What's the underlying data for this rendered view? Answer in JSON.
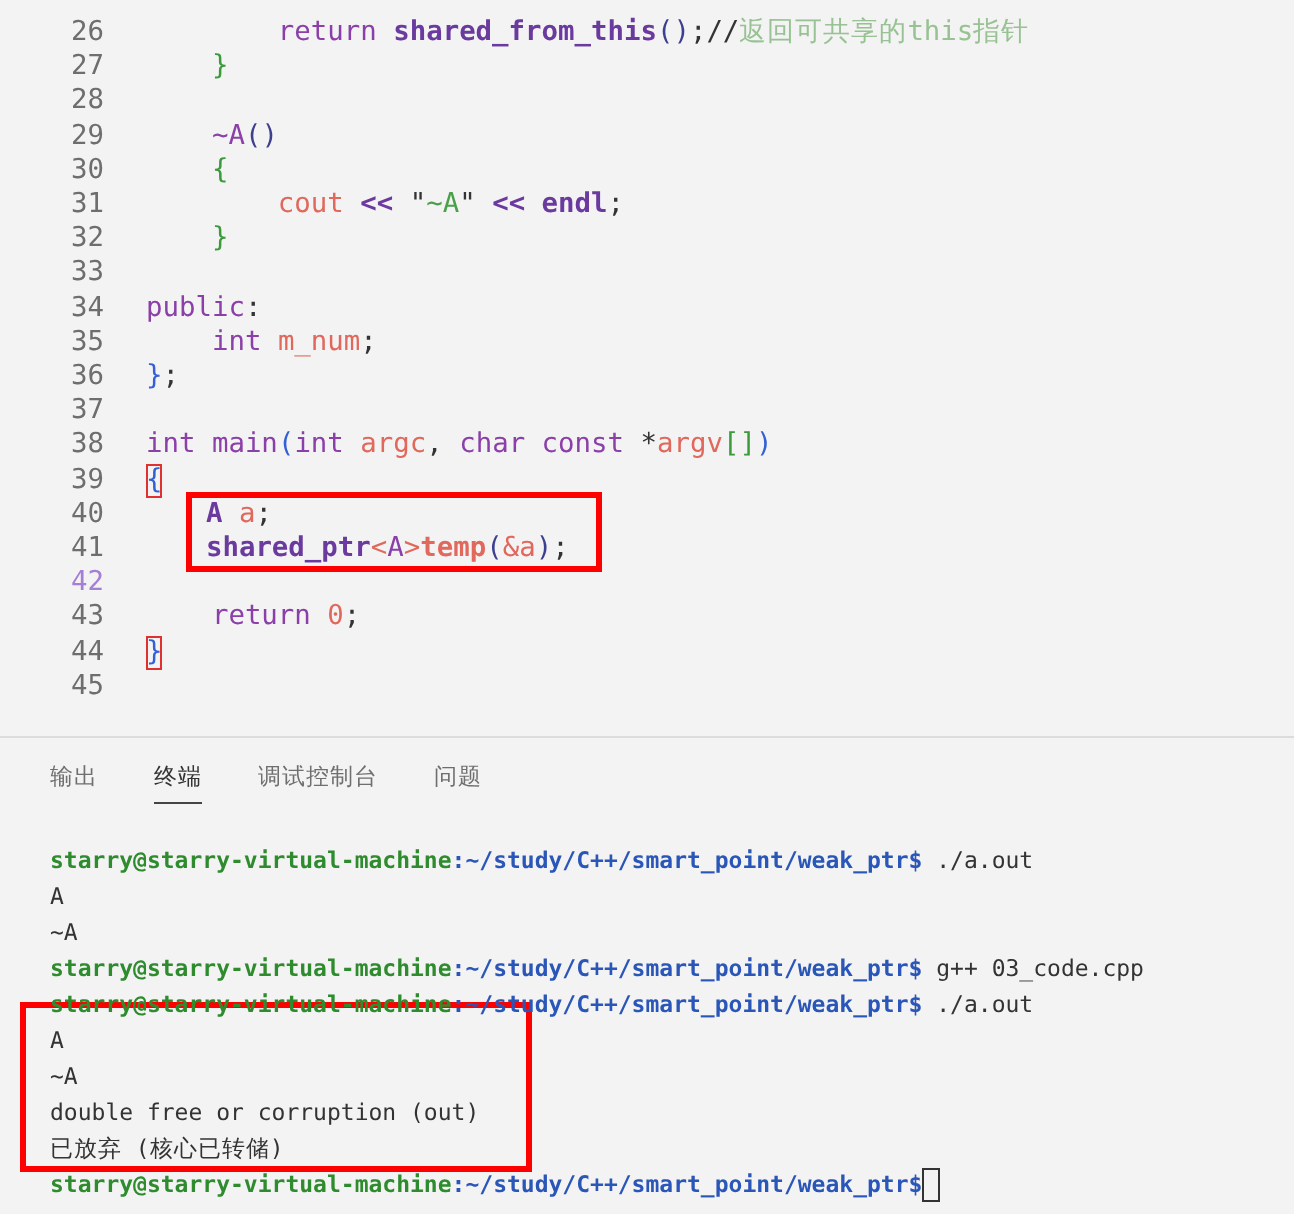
{
  "editor": {
    "lines": [
      {
        "number": "26",
        "current": false,
        "boxed": false,
        "bracket_match": false,
        "tokens": [
          {
            "kind": "keyword",
            "text": "        return "
          },
          {
            "kind": "function",
            "text": "shared_from_this"
          },
          {
            "kind": "paren",
            "text": "()"
          },
          {
            "kind": "plain",
            "text": ";//"
          },
          {
            "kind": "comment",
            "text": "返回可共享的this指针"
          }
        ]
      },
      {
        "number": "27",
        "current": false,
        "boxed": false,
        "bracket_match": false,
        "tokens": [
          {
            "kind": "brace",
            "text": "    }"
          }
        ]
      },
      {
        "number": "28",
        "current": false
      },
      {
        "number": "29",
        "current": false,
        "boxed": false,
        "bracket_match": false,
        "tokens": [
          {
            "kind": "keyword",
            "text": "    ~A"
          },
          {
            "kind": "paren",
            "text": "()"
          }
        ]
      },
      {
        "number": "30",
        "current": false,
        "boxed": false,
        "bracket_match": false,
        "tokens": [
          {
            "kind": "brace",
            "text": "    {"
          }
        ]
      },
      {
        "number": "31",
        "current": false,
        "boxed": false,
        "bracket_match": false,
        "tokens": [
          {
            "kind": "variable",
            "text": "        cout "
          },
          {
            "kind": "function",
            "text": "<<"
          },
          {
            "kind": "plain",
            "text": " \""
          },
          {
            "kind": "string",
            "text": "~A"
          },
          {
            "kind": "plain",
            "text": "\" "
          },
          {
            "kind": "function",
            "text": "<< endl"
          },
          {
            "kind": "plain",
            "text": ";"
          }
        ]
      },
      {
        "number": "32",
        "current": false,
        "boxed": false,
        "bracket_match": false,
        "tokens": [
          {
            "kind": "brace",
            "text": "    }"
          }
        ]
      },
      {
        "number": "33",
        "current": false
      },
      {
        "number": "34",
        "current": false,
        "boxed": false,
        "bracket_match": false,
        "tokens": [
          {
            "kind": "keyword",
            "text": "public"
          },
          {
            "kind": "plain",
            "text": ":"
          }
        ]
      },
      {
        "number": "35",
        "current": false,
        "boxed": false,
        "bracket_match": false,
        "tokens": [
          {
            "kind": "keyword",
            "text": "    int "
          },
          {
            "kind": "variable",
            "text": "m_num"
          },
          {
            "kind": "plain",
            "text": ";"
          }
        ]
      },
      {
        "number": "36",
        "current": false,
        "boxed": false,
        "bracket_match": false,
        "tokens": [
          {
            "kind": "outer",
            "text": "}"
          },
          {
            "kind": "plain",
            "text": ";"
          }
        ]
      },
      {
        "number": "37",
        "current": false
      },
      {
        "number": "38",
        "current": false,
        "boxed": false,
        "bracket_match": false,
        "tokens": [
          {
            "kind": "keyword",
            "text": "int main"
          },
          {
            "kind": "outer",
            "text": "("
          },
          {
            "kind": "keyword",
            "text": "int "
          },
          {
            "kind": "variable",
            "text": "argc"
          },
          {
            "kind": "plain",
            "text": ", "
          },
          {
            "kind": "keyword",
            "text": "char const "
          },
          {
            "kind": "plain",
            "text": "*"
          },
          {
            "kind": "variable",
            "text": "argv"
          },
          {
            "kind": "brace",
            "text": "[]"
          },
          {
            "kind": "outer",
            "text": ")"
          }
        ]
      },
      {
        "number": "39",
        "current": false,
        "boxed": false,
        "bracket_match": true,
        "tokens": [
          {
            "kind": "outer",
            "text": "{"
          }
        ]
      },
      {
        "number": "40",
        "current": false,
        "boxed": true,
        "bracket_match": false,
        "tokens": [
          {
            "kind": "function",
            "text": "    A "
          },
          {
            "kind": "variable",
            "text": "a"
          },
          {
            "kind": "plain",
            "text": ";"
          }
        ]
      },
      {
        "number": "41",
        "current": false,
        "boxed": true,
        "bracket_match": false,
        "tokens": [
          {
            "kind": "function",
            "text": "    shared_ptr"
          },
          {
            "kind": "variable",
            "text": "<"
          },
          {
            "kind": "keyword",
            "text": "A"
          },
          {
            "kind": "variable",
            "text": ">"
          },
          {
            "kind": "callee",
            "text": "temp"
          },
          {
            "kind": "paren",
            "text": "("
          },
          {
            "kind": "variable",
            "text": "&a"
          },
          {
            "kind": "paren",
            "text": ")"
          },
          {
            "kind": "plain",
            "text": ";"
          }
        ]
      },
      {
        "number": "42",
        "current": true
      },
      {
        "number": "43",
        "current": false,
        "boxed": false,
        "bracket_match": false,
        "tokens": [
          {
            "kind": "keyword",
            "text": "    return "
          },
          {
            "kind": "number",
            "text": "0"
          },
          {
            "kind": "plain",
            "text": ";"
          }
        ]
      },
      {
        "number": "44",
        "current": false,
        "boxed": false,
        "bracket_match": true,
        "tokens": [
          {
            "kind": "outer",
            "text": "}"
          }
        ]
      },
      {
        "number": "45",
        "current": false
      }
    ]
  },
  "panel": {
    "tabs": [
      {
        "label": "输出",
        "selected": false
      },
      {
        "label": "终端",
        "selected": true
      },
      {
        "label": "调试控制台",
        "selected": false
      },
      {
        "label": "问题",
        "selected": false
      }
    ],
    "terminal": [
      {
        "kind": "prompt",
        "boxed": false,
        "user": "starry@starry-virtual-machine",
        "path": ":~/study/C++/smart_point/weak_ptr$",
        "command": " ./a.out",
        "cursor": false
      },
      {
        "kind": "output",
        "boxed": false,
        "text": "A"
      },
      {
        "kind": "output",
        "boxed": false,
        "text": "~A"
      },
      {
        "kind": "prompt",
        "boxed": false,
        "user": "starry@starry-virtual-machine",
        "path": ":~/study/C++/smart_point/weak_ptr$",
        "command": " g++ 03_code.cpp",
        "cursor": false
      },
      {
        "kind": "prompt",
        "boxed": false,
        "user": "starry@starry-virtual-machine",
        "path": ":~/study/C++/smart_point/weak_ptr$",
        "command": " ./a.out",
        "cursor": false
      },
      {
        "kind": "output",
        "boxed": true,
        "text": "A"
      },
      {
        "kind": "output",
        "boxed": true,
        "text": "~A"
      },
      {
        "kind": "output",
        "boxed": true,
        "text": "double free or corruption (out)"
      },
      {
        "kind": "output",
        "boxed": true,
        "text": "已放弃 (核心已转储)"
      },
      {
        "kind": "prompt",
        "boxed": false,
        "user": "starry@starry-virtual-machine",
        "path": ":~/study/C++/smart_point/weak_ptr$",
        "cursor": true
      }
    ]
  }
}
